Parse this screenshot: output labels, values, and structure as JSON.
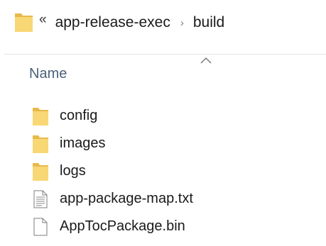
{
  "address_bar": {
    "overflow_glyph": "«",
    "breadcrumbs": [
      {
        "label": "app-release-exec"
      },
      {
        "label": "build"
      }
    ],
    "separator_glyph": "›"
  },
  "file_list": {
    "column_header": "Name",
    "sort": "ascending",
    "items": [
      {
        "name": "config",
        "icon": "folder-icon"
      },
      {
        "name": "images",
        "icon": "folder-icon"
      },
      {
        "name": "logs",
        "icon": "folder-icon"
      },
      {
        "name": "app-package-map.txt",
        "icon": "text-file-icon"
      },
      {
        "name": "AppTocPackage.bin",
        "icon": "blank-file-icon"
      }
    ]
  },
  "colors": {
    "folder": "#f8d775",
    "folder_dark": "#e8b84a",
    "header_text": "#4c607a",
    "divider": "#e3e3e3"
  }
}
